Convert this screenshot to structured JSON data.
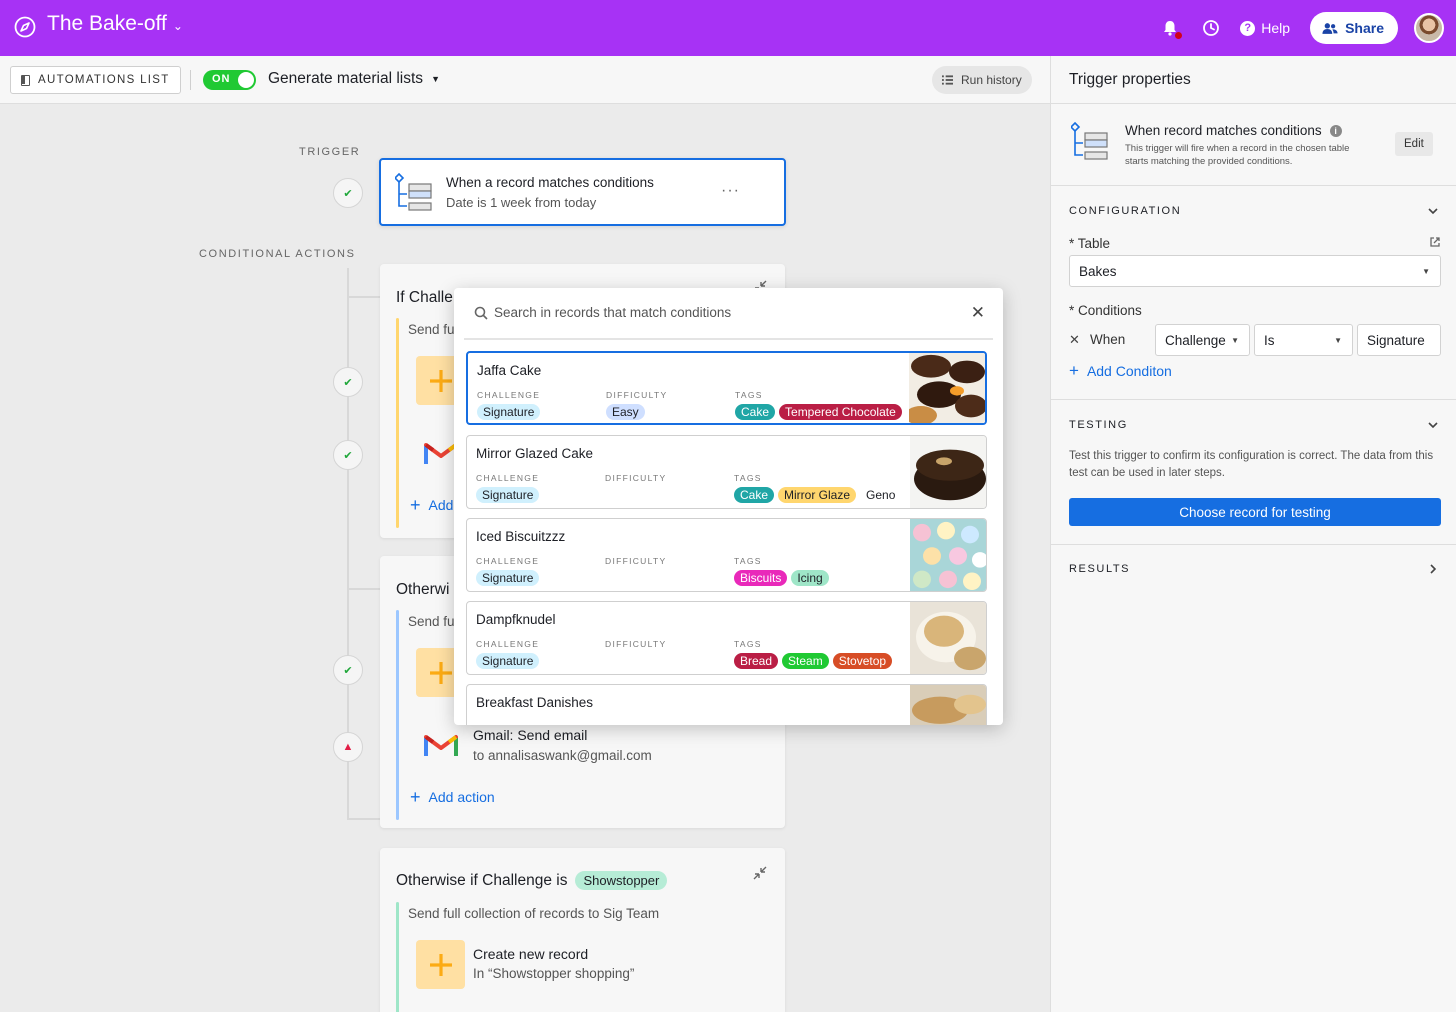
{
  "topbar": {
    "base_name": "The Bake-off",
    "help_label": "Help",
    "share_label": "Share"
  },
  "toolbar": {
    "automations_list_label": "AUTOMATIONS LIST",
    "toggle_label": "ON",
    "automation_name": "Generate material lists",
    "run_history_label": "Run history"
  },
  "canvas": {
    "trigger_section_label": "TRIGGER",
    "conditional_section_label": "CONDITIONAL ACTIONS",
    "trigger": {
      "title": "When a record matches conditions",
      "subtitle": "Date is 1 week from today",
      "menu": "···"
    },
    "groups": [
      {
        "title": "If Challe",
        "subtitle": "Send fu",
        "actions": [],
        "add_action_partial": "Add"
      },
      {
        "title": "Otherwi",
        "subtitle": "Send fu",
        "actions": [
          {
            "title": "Gmail: Send email",
            "subtitle": "to annalisaswank@gmail.com"
          }
        ],
        "add_action": "Add action"
      },
      {
        "title": "Otherwise if Challenge is",
        "pill": "Showstopper",
        "subtitle": "Send full collection of records to Sig Team",
        "actions": [
          {
            "title": "Create new record",
            "subtitle": "In “Showstopper shopping”"
          }
        ]
      }
    ]
  },
  "popup": {
    "search_placeholder": "Search in records that match conditions",
    "field_labels": {
      "challenge": "CHALLENGE",
      "difficulty": "DIFFICULTY",
      "tags": "TAGS"
    },
    "records": [
      {
        "name": "Jaffa Cake",
        "challenge": "Signature",
        "difficulty": "Easy",
        "tags": [
          "Cake",
          "Tempered Chocolate"
        ]
      },
      {
        "name": "Mirror Glazed Cake",
        "challenge": "Signature",
        "difficulty": "",
        "tags": [
          "Cake",
          "Mirror Glaze",
          "Geno"
        ]
      },
      {
        "name": "Iced Biscuitzzz",
        "challenge": "Signature",
        "difficulty": "",
        "tags": [
          "Biscuits",
          "Icing"
        ]
      },
      {
        "name": "Dampfknudel",
        "challenge": "Signature",
        "difficulty": "",
        "tags": [
          "Bread",
          "Steam",
          "Stovetop"
        ]
      },
      {
        "name": "Breakfast Danishes",
        "challenge": "",
        "difficulty": "",
        "tags": []
      }
    ]
  },
  "right_panel": {
    "title": "Trigger properties",
    "trigger": {
      "heading": "When record matches conditions",
      "description": "This trigger will fire when a record in the chosen table starts matching the provided conditions.",
      "edit_label": "Edit"
    },
    "configuration": {
      "section_title": "CONFIGURATION",
      "table_label": "* Table",
      "table_value": "Bakes",
      "conditions_label": "* Conditions",
      "when_label": "When",
      "field_value": "Challenge",
      "operator_value": "Is",
      "value": "Signature",
      "add_condition": "Add Conditon"
    },
    "testing": {
      "section_title": "TESTING",
      "description": "Test this trigger to confirm its configuration is correct. The data from this test can be used in later steps.",
      "button_label": "Choose record for testing"
    },
    "results": {
      "section_title": "RESULTS"
    }
  }
}
